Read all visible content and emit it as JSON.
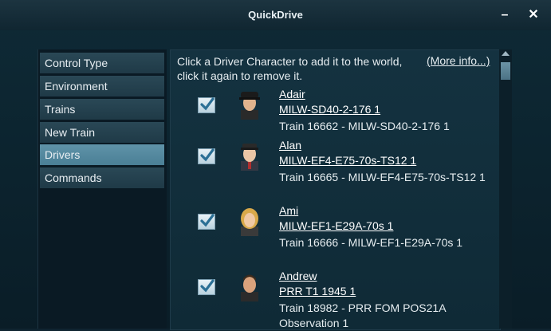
{
  "window": {
    "title": "QuickDrive",
    "minimize_label": "–",
    "close_label": "✕"
  },
  "sidebar": {
    "items": [
      {
        "label": "Control Type"
      },
      {
        "label": "Environment"
      },
      {
        "label": "Trains"
      },
      {
        "label": "New Train"
      },
      {
        "label": "Drivers",
        "active": true
      },
      {
        "label": "Commands"
      }
    ]
  },
  "panel": {
    "intro": "Click a Driver Character to add it to the world, click it again to remove it.",
    "more_info": "(More info...)"
  },
  "drivers": [
    {
      "name": "Adair",
      "link": "MILW-SD40-2-176 1",
      "train": "Train 16662 - MILW-SD40-2-176 1",
      "checked": true
    },
    {
      "name": "Alan",
      "link": "MILW-EF4-E75-70s-TS12 1",
      "train": "Train 16665 - MILW-EF4-E75-70s-TS12 1",
      "checked": true
    },
    {
      "name": "Ami",
      "link": "MILW-EF1-E29A-70s 1",
      "train": "Train 16666 - MILW-EF1-E29A-70s 1",
      "checked": true
    },
    {
      "name": "Andrew",
      "link": "PRR T1 1945 1",
      "train": "Train 18982 - PRR FOM POS21A Observation 1",
      "checked": true
    }
  ],
  "icons": {
    "check": "check-icon",
    "scroll_up": "arrow-up-icon"
  },
  "colors": {
    "accent": "#5f93a8",
    "nav": "#2a4856",
    "panel": "#143240"
  }
}
